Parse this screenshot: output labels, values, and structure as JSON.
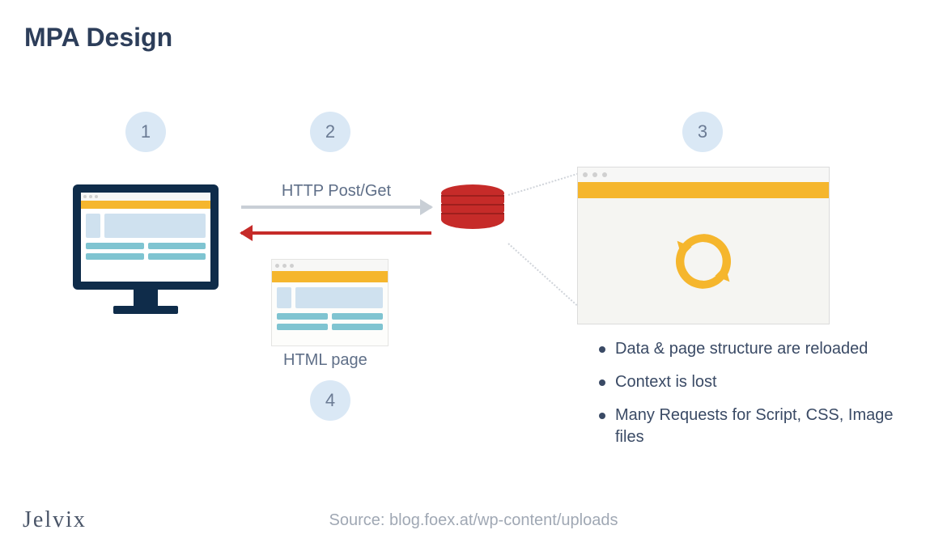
{
  "title": "MPA Design",
  "badges": {
    "b1": "1",
    "b2": "2",
    "b3": "3",
    "b4": "4"
  },
  "arrows": {
    "request_label": "HTTP Post/Get"
  },
  "html_page_label": "HTML page",
  "bullets": {
    "item1": "Data & page structure are reloaded",
    "item2": "Context is lost",
    "item3": "Many Requests for Script, CSS, Image files"
  },
  "footer": {
    "logo": "Jelvix",
    "source": "Source: blog.foex.at/wp-content/uploads"
  },
  "colors": {
    "accent_orange": "#f5b62d",
    "accent_red": "#c62b29",
    "badge_bg": "#dae8f5",
    "text_primary": "#2d3e5a"
  }
}
